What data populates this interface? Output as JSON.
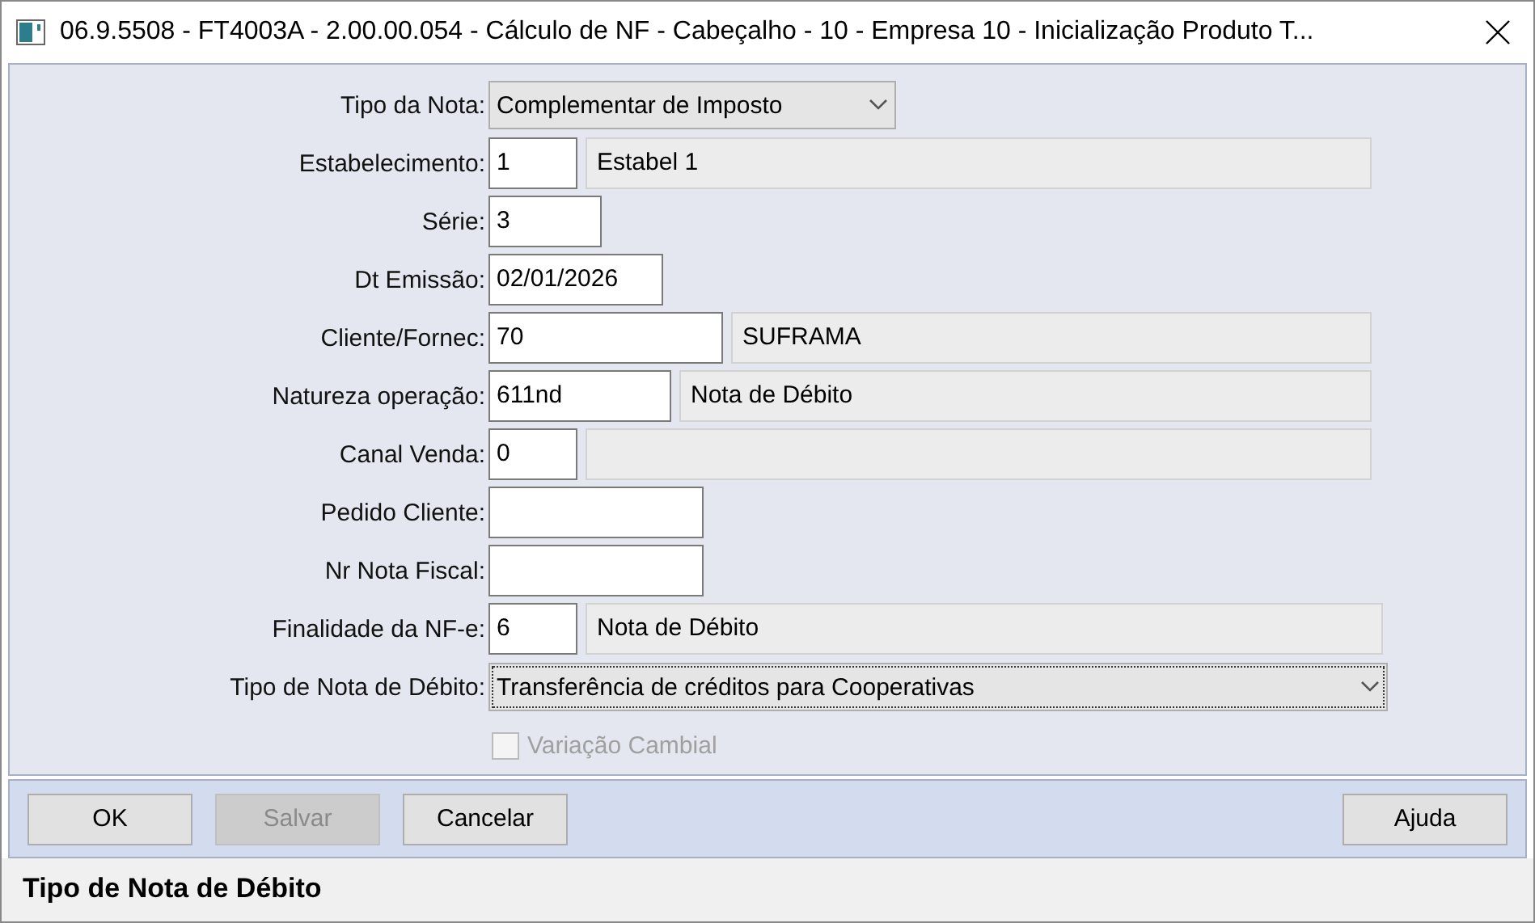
{
  "window": {
    "title": "06.9.5508 - FT4003A - 2.00.00.054 - Cálculo de NF - Cabeçalho - 10 - Empresa 10 - Inicialização Produto T..."
  },
  "form": [
    {
      "label": "Tipo da Nota:",
      "fields": [
        {
          "kind": "select",
          "value": "Complementar de Imposto",
          "focused": false
        }
      ]
    },
    {
      "label": "Estabelecimento:",
      "fields": [
        {
          "kind": "input",
          "value": "1"
        },
        {
          "kind": "readonly",
          "value": "Estabel 1"
        }
      ]
    },
    {
      "label": "Série:",
      "fields": [
        {
          "kind": "input",
          "value": "3"
        }
      ]
    },
    {
      "label": "Dt Emissão:",
      "fields": [
        {
          "kind": "input",
          "value": "02/01/2026"
        }
      ]
    },
    {
      "label": "Cliente/Fornec:",
      "fields": [
        {
          "kind": "input",
          "value": "70"
        },
        {
          "kind": "readonly",
          "value": "SUFRAMA"
        }
      ]
    },
    {
      "label": "Natureza operação:",
      "fields": [
        {
          "kind": "input",
          "value": "611nd"
        },
        {
          "kind": "readonly",
          "value": "Nota de Débito"
        }
      ]
    },
    {
      "label": "Canal Venda:",
      "fields": [
        {
          "kind": "input",
          "value": "0"
        },
        {
          "kind": "readonly"
        }
      ]
    },
    {
      "label": "Pedido Cliente:",
      "fields": [
        {
          "kind": "input"
        }
      ]
    },
    {
      "label": "Nr Nota Fiscal:",
      "fields": [
        {
          "kind": "input"
        }
      ]
    },
    {
      "label": "Finalidade da NF-e:",
      "fields": [
        {
          "kind": "input",
          "value": "6"
        },
        {
          "kind": "readonly",
          "value": "Nota de Débito"
        }
      ]
    },
    {
      "label": "Tipo de Nota de Débito:",
      "fields": [
        {
          "kind": "select",
          "value": "Transferência de créditos para Cooperativas",
          "focused": true
        }
      ]
    }
  ],
  "checkbox": {
    "label": "Variação Cambial",
    "checked": false,
    "disabled": true
  },
  "buttons": [
    {
      "label": "OK",
      "disabled": false
    },
    {
      "label": "Salvar",
      "disabled": true
    },
    {
      "label": "Cancelar",
      "disabled": false
    }
  ],
  "help_button": {
    "label": "Ajuda",
    "disabled": false
  },
  "status_bar": "Tipo de Nota de Débito"
}
